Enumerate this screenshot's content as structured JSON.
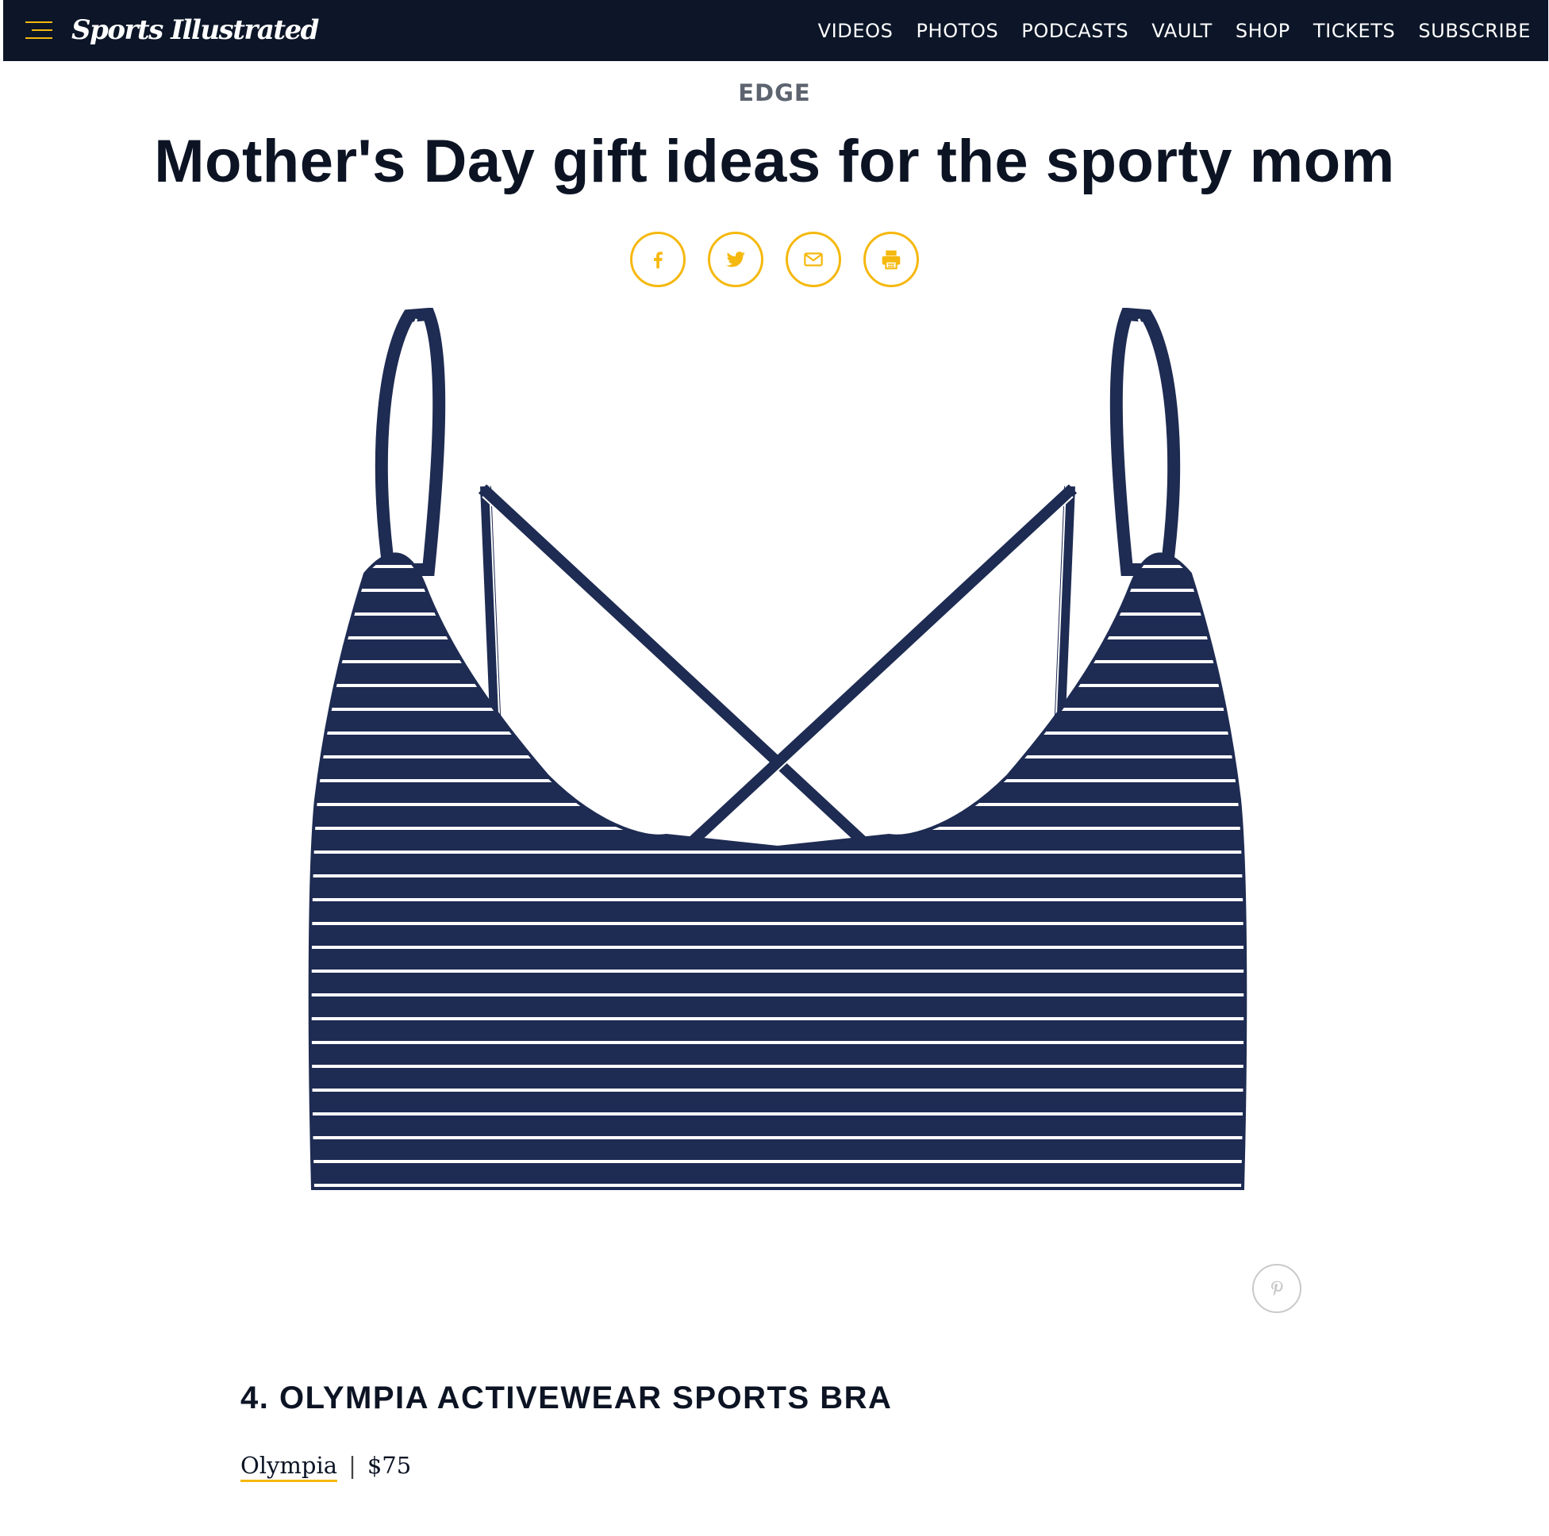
{
  "brand": {
    "logo_text": "Sports Illustrated",
    "accent_color": "#f5b80e",
    "nav_background": "#0c1628"
  },
  "nav": {
    "items": [
      {
        "label": "VIDEOS"
      },
      {
        "label": "PHOTOS"
      },
      {
        "label": "PODCASTS"
      },
      {
        "label": "VAULT"
      },
      {
        "label": "SHOP"
      },
      {
        "label": "TICKETS"
      },
      {
        "label": "SUBSCRIBE"
      }
    ]
  },
  "article": {
    "section": "EDGE",
    "title": "Mother's Day gift ideas for the sporty mom",
    "share_icons": [
      "facebook-icon",
      "twitter-icon",
      "email-icon",
      "print-icon"
    ]
  },
  "gallery_item": {
    "image_icon": "pinterest-icon",
    "image_colors": {
      "fabric": "#1e2b52",
      "stripe": "#ffffff"
    },
    "title": "4. OLYMPIA ACTIVEWEAR SPORTS BRA",
    "brand": "Olympia",
    "separator": "|",
    "price": "$75"
  }
}
